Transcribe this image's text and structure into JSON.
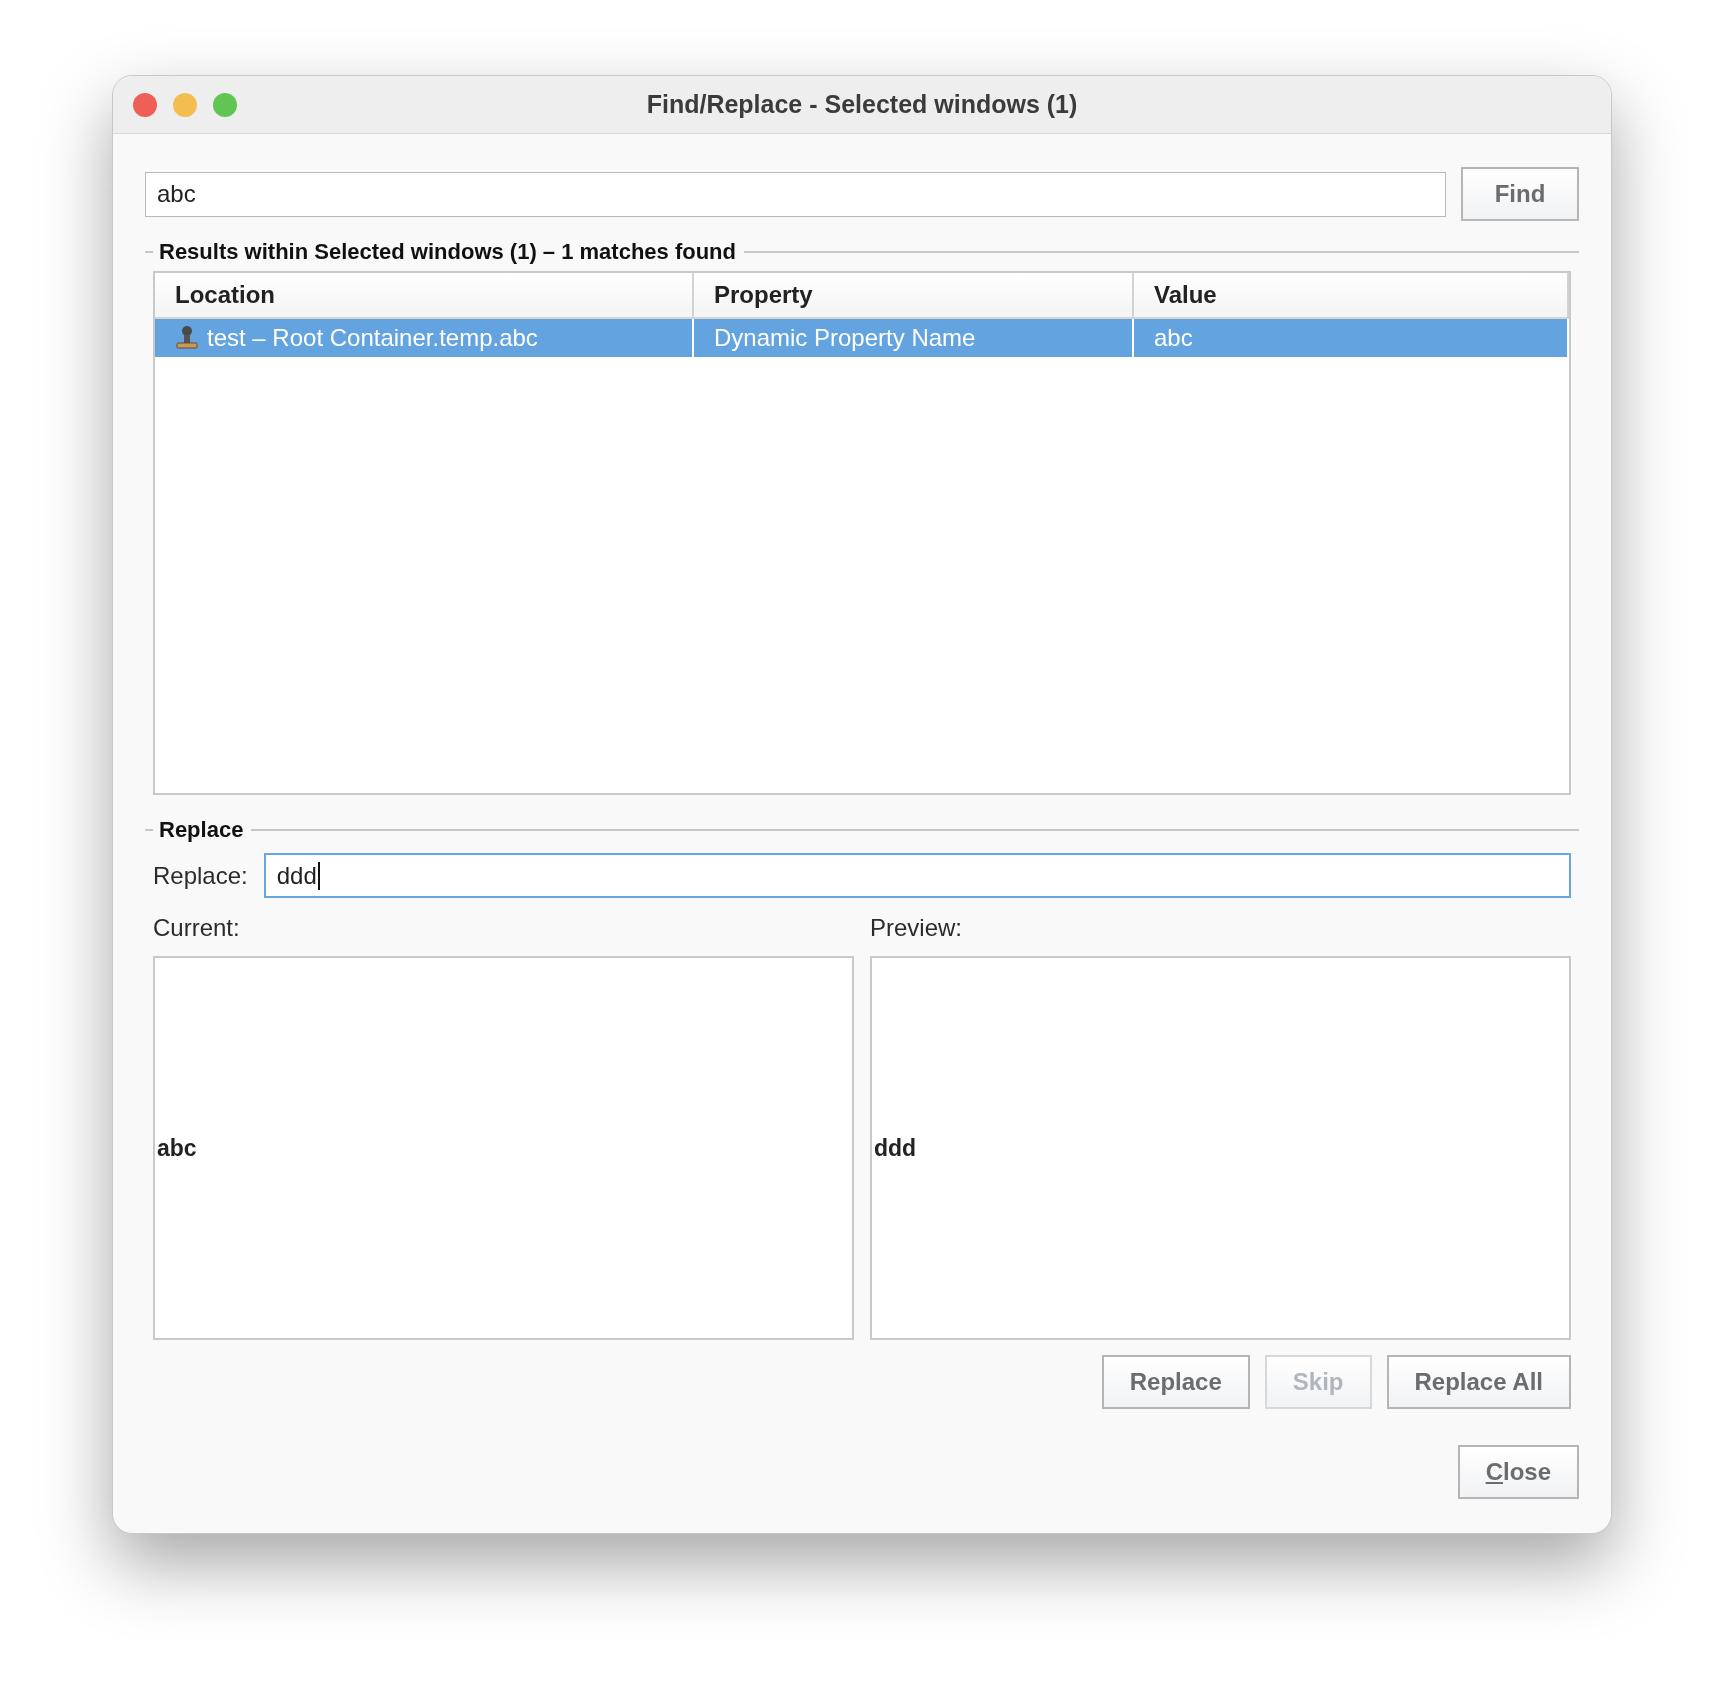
{
  "window": {
    "title": "Find/Replace - Selected windows (1)"
  },
  "search": {
    "value": "abc",
    "button": "Find"
  },
  "results": {
    "legend": "Results within Selected windows (1) – 1 matches found",
    "columns": [
      "Location",
      "Property",
      "Value"
    ],
    "rows": [
      {
        "selected": true,
        "cells": [
          "test – Root Container.temp.abc",
          "Dynamic Property Name",
          "abc"
        ]
      }
    ]
  },
  "replace": {
    "legend": "Replace",
    "label": "Replace:",
    "value": "ddd",
    "focused": true,
    "current_label": "Current:",
    "preview_label": "Preview:",
    "current_text": "abc",
    "preview_text": "ddd",
    "buttons": [
      {
        "label": "Replace",
        "disabled": false
      },
      {
        "label": "Skip",
        "disabled": true
      },
      {
        "label": "Replace All",
        "disabled": false
      }
    ]
  },
  "close": {
    "label": "Close",
    "mnemonic_underlined": true
  }
}
